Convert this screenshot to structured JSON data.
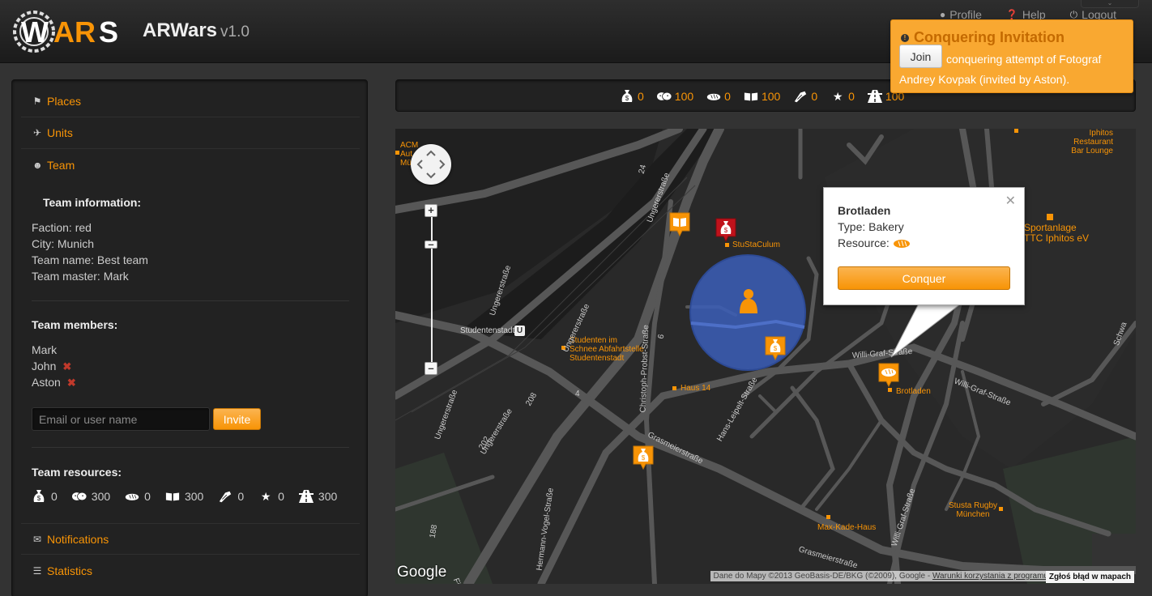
{
  "app": {
    "logo_text": "WARS",
    "name": "ARWars",
    "version": "v1.0",
    "accent": "#f89406"
  },
  "topnav": [
    {
      "label": "Profile",
      "icon": "user-icon"
    },
    {
      "label": "Help",
      "icon": "question-icon"
    },
    {
      "label": "Logout",
      "icon": "power-icon"
    }
  ],
  "sidebar": {
    "nav": {
      "places": "Places",
      "units": "Units",
      "team": "Team",
      "notifications": "Notifications",
      "statistics": "Statistics"
    },
    "team_info": {
      "title": "Team information:",
      "faction": "Faction: red",
      "city": "City: Munich",
      "team_name": "Team name: Best team",
      "team_master": "Team master: Mark"
    },
    "team_members": {
      "title": "Team members:",
      "members": [
        "Mark",
        "John",
        "Aston"
      ]
    },
    "invite": {
      "placeholder": "Email or user name",
      "button": "Invite"
    },
    "team_resources": {
      "title": "Team resources:",
      "items": [
        {
          "icon": "money-bag-icon",
          "value": "0"
        },
        {
          "icon": "theater-masks-icon",
          "value": "300"
        },
        {
          "icon": "bread-icon",
          "value": "0"
        },
        {
          "icon": "book-icon",
          "value": "300"
        },
        {
          "icon": "tool-icon",
          "value": "0"
        },
        {
          "icon": "star-icon",
          "value": "0"
        },
        {
          "icon": "road-icon",
          "value": "300"
        }
      ]
    }
  },
  "resource_bar": [
    {
      "icon": "money-bag-icon",
      "value": "0"
    },
    {
      "icon": "theater-masks-icon",
      "value": "100"
    },
    {
      "icon": "bread-icon",
      "value": "0"
    },
    {
      "icon": "book-icon",
      "value": "100"
    },
    {
      "icon": "tool-icon",
      "value": "0"
    },
    {
      "icon": "star-icon",
      "value": "0"
    },
    {
      "icon": "road-icon",
      "value": "100"
    }
  ],
  "map": {
    "popup": {
      "title": "Brotladen",
      "type": "Type: Bakery",
      "resource_label": "Resource:",
      "button": "Conquer"
    },
    "labels": {
      "acm": "ACM",
      "acm2": "Aut",
      "acm3": "Mü",
      "iphitos": "Iphitos",
      "restaurant": "Restaurant",
      "barlounge": "Bar Lounge",
      "sportanlage": "Sportanlage",
      "ttc": "TTC Iphitos eV",
      "stusta": "StuStaCulum",
      "studentenstadt": "Studentenstadt",
      "studenten1": "Studenten im",
      "studenten2": "Schnee Abfahrtstelle",
      "studenten3": "Studentenstadt",
      "haus14": "Haus 14",
      "brotladen": "Brotladen",
      "stusta_rugby1": "Stusta Rugby",
      "stusta_rugby2": "München",
      "maxkade": "Max-Kade-Haus",
      "ungerer1": "Ungererstraße",
      "ungerer2": "Ungererstraße",
      "ungerer3": "Ungererstraße",
      "ungerer4": "Ungererstraße",
      "ungerer5": "Ungererstraße",
      "willigraf1": "Willi-Graf-Straße",
      "willigraf2": "Willi-Graf-Straße",
      "willigraf3": "Willi-Graf-Straße",
      "christoph": "Christoph-Probst-Straße",
      "hansleipelt": "Hans-Leipelt-Straße",
      "grasmeier1": "Grasmeierstraße",
      "grasmeier2": "Grasmeierstraße",
      "hermann": "Hermann-Vogel-Straße",
      "schwa": "Schwa",
      "u": "U",
      "n24": "24",
      "n208": "208",
      "n202": "202",
      "n4": "4",
      "n6": "6",
      "n188": "188",
      "fina": "Fina"
    },
    "google": "Google",
    "attribution_prefix": "Dane do Mapy ©2013 GeoBasis-DE/BKG (©2009), Google - ",
    "attribution_link": "Warunki korzystania z programu",
    "report": "Zgłoś błąd w mapach"
  },
  "toast": {
    "title": "Conquering Invitation",
    "join": "Join",
    "message": "conquering attempt of Fotograf Andrey Kovpak (invited by Aston)."
  }
}
